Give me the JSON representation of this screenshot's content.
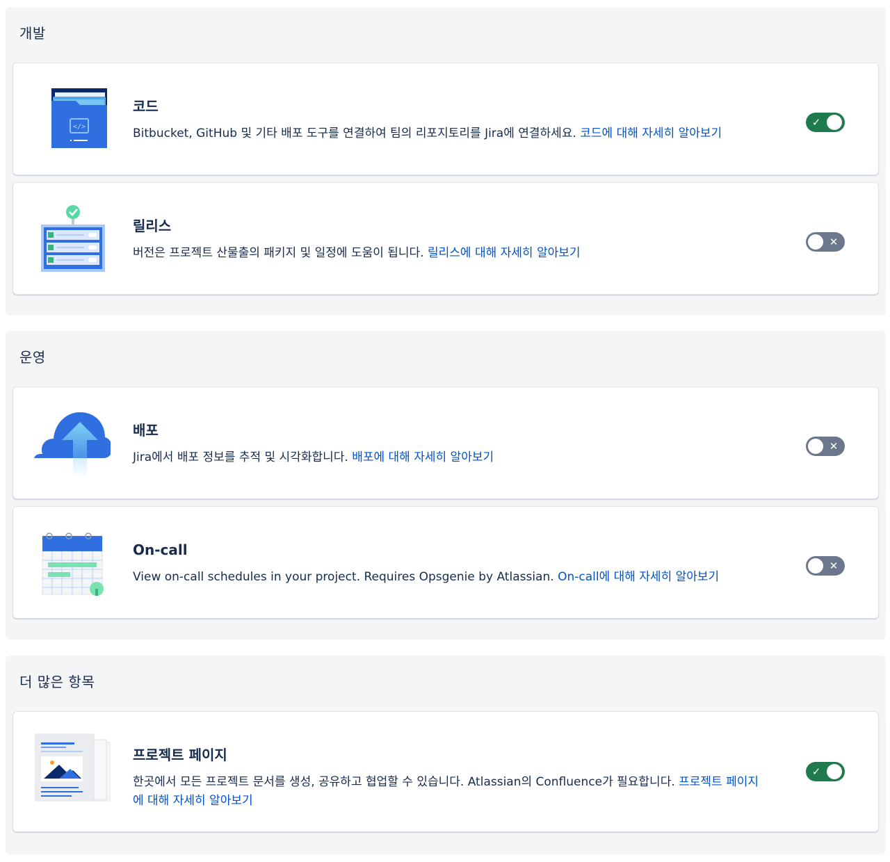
{
  "sections": [
    {
      "title": "개발",
      "cards": [
        {
          "title": "코드",
          "description": "Bitbucket, GitHub 및 기타 배포 도구를 연결하여 팀의 리포지토리를 Jira에 연결하세요.",
          "link": "코드에 대해 자세히 알아보기",
          "enabled": true,
          "icon": "code-folder-icon"
        },
        {
          "title": "릴리스",
          "description": "버전은 프로젝트 산물출의 패키지 및 일정에 도움이 됩니다.",
          "link": "릴리스에 대해 자세히 알아보기",
          "enabled": false,
          "icon": "release-list-icon"
        }
      ]
    },
    {
      "title": "운영",
      "cards": [
        {
          "title": "배포",
          "description": "Jira에서 배포 정보를 추적 및 시각화합니다.",
          "link": "배포에 대해 자세히 알아보기",
          "enabled": false,
          "icon": "cloud-upload-icon"
        },
        {
          "title": "On-call",
          "description": "View on-call schedules in your project. Requires Opsgenie by Atlassian.",
          "link": "On-call에 대해 자세히 알아보기",
          "enabled": false,
          "icon": "calendar-icon"
        }
      ]
    },
    {
      "title": "더 많은 항목",
      "cards": [
        {
          "title": "프로젝트 페이지",
          "description": "한곳에서 모든 프로젝트 문서를 생성, 공유하고 협업할 수 있습니다. Atlassian의 Confluence가 필요합니다.",
          "link": "프로젝트 페이지에 대해 자세히 알아보기",
          "enabled": true,
          "icon": "document-pages-icon"
        }
      ]
    }
  ],
  "toggle_marks": {
    "on": "✓",
    "off": "✕"
  },
  "colors": {
    "link": "#0052cc",
    "toggle_on": "#1f7a4d",
    "toggle_off": "#6b778c",
    "section_bg": "#f4f5f7"
  }
}
